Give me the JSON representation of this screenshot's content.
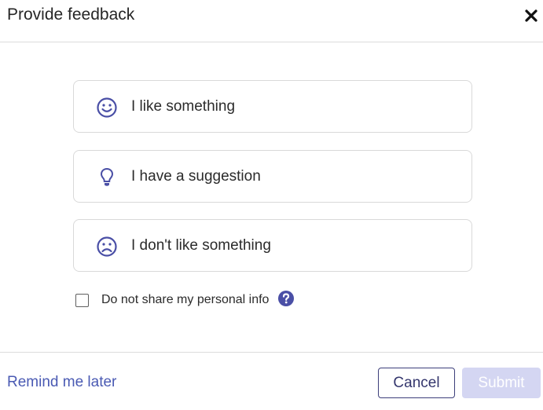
{
  "dialog": {
    "title": "Provide feedback",
    "close_icon": "close-icon"
  },
  "options": [
    {
      "label": "I like something",
      "icon": "smile-icon"
    },
    {
      "label": "I have a suggestion",
      "icon": "lightbulb-icon"
    },
    {
      "label": "I don't like something",
      "icon": "frown-icon"
    }
  ],
  "privacy": {
    "label": "Do not share my personal info",
    "checked": false,
    "help_icon": "help-icon"
  },
  "footer": {
    "remind_label": "Remind me later",
    "cancel_label": "Cancel",
    "submit_label": "Submit"
  },
  "colors": {
    "accent": "#4a4fa6",
    "link": "#4a5ab3",
    "submit_disabled": "#d4d6f2"
  }
}
